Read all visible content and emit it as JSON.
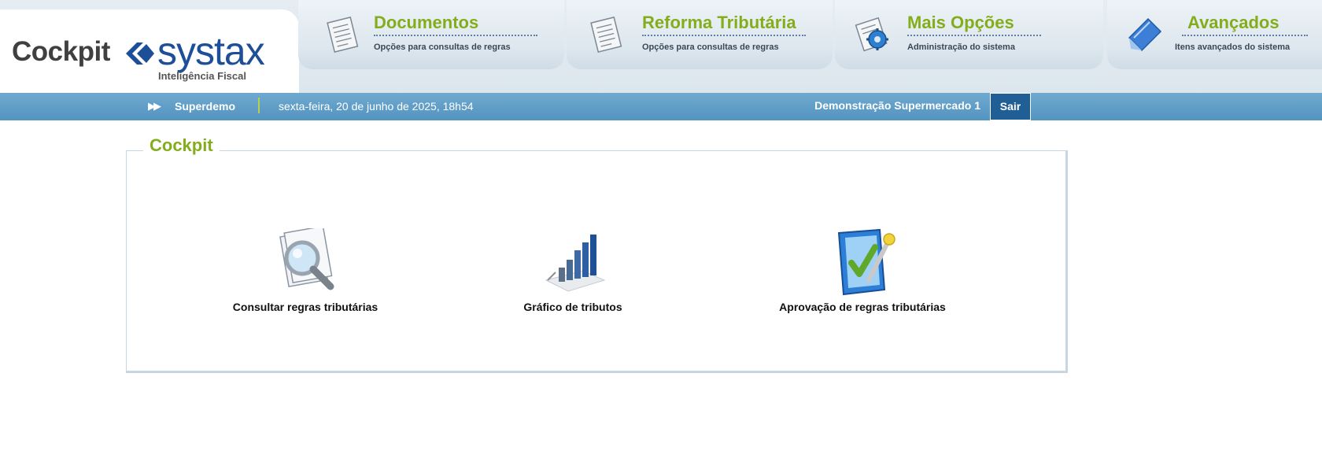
{
  "brand": {
    "word": "Cockpit",
    "name": "systax",
    "tagline": "Inteligência Fiscal"
  },
  "nav": [
    {
      "title": "Documentos",
      "subtitle": "Opções para consultas de regras",
      "icon": "document-icon"
    },
    {
      "title": "Reforma Tributária",
      "subtitle": "Opções para consultas de regras",
      "icon": "document-icon"
    },
    {
      "title": "Mais Opções",
      "subtitle": "Administração do sistema",
      "icon": "gear-document-icon"
    },
    {
      "title": "Avançados",
      "subtitle": "Itens avançados do sistema",
      "icon": "pencil-icon"
    }
  ],
  "status": {
    "user": "Superdemo",
    "datetime": "sexta-feira, 20 de junho de 2025, 18h54",
    "company": "Demonstração Supermercado 1",
    "logout_label": "Sair"
  },
  "panel": {
    "title": "Cockpit",
    "items": [
      {
        "label": "Consultar regras tributárias",
        "icon": "magnifier-document-icon"
      },
      {
        "label": "Gráfico de tributos",
        "icon": "bar-chart-icon"
      },
      {
        "label": "Aprovação de regras tributárias",
        "icon": "approval-check-icon"
      }
    ]
  },
  "colors": {
    "accent_green": "#84ad1c",
    "brand_blue": "#1d4f98",
    "status_bar": "#5394c0",
    "logout_button": "#1f5f95"
  }
}
